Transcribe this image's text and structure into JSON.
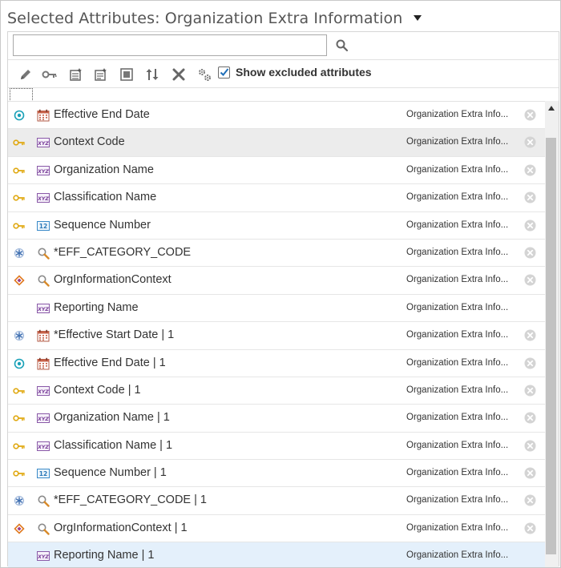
{
  "header": {
    "title": "Selected Attributes: Organization Extra Information"
  },
  "search": {
    "value": "",
    "placeholder": ""
  },
  "toolbar": {
    "icons": [
      "edit-icon",
      "key-icon",
      "add-attribute-icon",
      "add-derived-attribute-icon",
      "properties-icon",
      "sort-icon",
      "delete-icon",
      "settings-icon"
    ],
    "show_excluded_label": "Show excluded attributes",
    "show_excluded_checked": true
  },
  "rows": [
    {
      "lead": "target-icon",
      "type": "calendar-icon",
      "name": "Effective End Date",
      "object": "Organization Extra Info...",
      "removable": true,
      "state": "normal"
    },
    {
      "lead": "key-icon",
      "type": "text-type-icon",
      "name": "Context Code",
      "object": "Organization Extra Info...",
      "removable": true,
      "state": "hover"
    },
    {
      "lead": "key-icon",
      "type": "text-type-icon",
      "name": "Organization Name",
      "object": "Organization Extra Info...",
      "removable": true,
      "state": "normal"
    },
    {
      "lead": "key-icon",
      "type": "text-type-icon",
      "name": "Classification Name",
      "object": "Organization Extra Info...",
      "removable": true,
      "state": "normal"
    },
    {
      "lead": "key-icon",
      "type": "number-type-icon",
      "name": "Sequence Number",
      "object": "Organization Extra Info...",
      "removable": true,
      "state": "normal"
    },
    {
      "lead": "asterisk-icon",
      "type": "lookup-icon",
      "name": "*EFF_CATEGORY_CODE",
      "object": "Organization Extra Info...",
      "removable": true,
      "state": "normal"
    },
    {
      "lead": "diamond-icon",
      "type": "lookup-icon",
      "name": "OrgInformationContext",
      "object": "Organization Extra Info...",
      "removable": true,
      "state": "normal"
    },
    {
      "lead": "",
      "type": "text-type-icon",
      "name": "Reporting Name",
      "object": "Organization Extra Info...",
      "removable": false,
      "state": "normal"
    },
    {
      "lead": "asterisk-icon",
      "type": "calendar-icon",
      "name": "*Effective Start Date | 1",
      "object": "Organization Extra Info...",
      "removable": true,
      "state": "normal"
    },
    {
      "lead": "target-icon",
      "type": "calendar-icon",
      "name": "Effective End Date | 1",
      "object": "Organization Extra Info...",
      "removable": true,
      "state": "normal"
    },
    {
      "lead": "key-icon",
      "type": "text-type-icon",
      "name": "Context Code | 1",
      "object": "Organization Extra Info...",
      "removable": true,
      "state": "normal"
    },
    {
      "lead": "key-icon",
      "type": "text-type-icon",
      "name": "Organization Name | 1",
      "object": "Organization Extra Info...",
      "removable": true,
      "state": "normal"
    },
    {
      "lead": "key-icon",
      "type": "text-type-icon",
      "name": "Classification Name | 1",
      "object": "Organization Extra Info...",
      "removable": true,
      "state": "normal"
    },
    {
      "lead": "key-icon",
      "type": "number-type-icon",
      "name": "Sequence Number | 1",
      "object": "Organization Extra Info...",
      "removable": true,
      "state": "normal"
    },
    {
      "lead": "asterisk-icon",
      "type": "lookup-icon",
      "name": "*EFF_CATEGORY_CODE | 1",
      "object": "Organization Extra Info...",
      "removable": true,
      "state": "normal"
    },
    {
      "lead": "diamond-icon",
      "type": "lookup-icon",
      "name": "OrgInformationContext | 1",
      "object": "Organization Extra Info...",
      "removable": true,
      "state": "normal"
    },
    {
      "lead": "",
      "type": "text-type-icon",
      "name": "Reporting Name | 1",
      "object": "Organization Extra Info...",
      "removable": false,
      "state": "selected"
    }
  ]
}
